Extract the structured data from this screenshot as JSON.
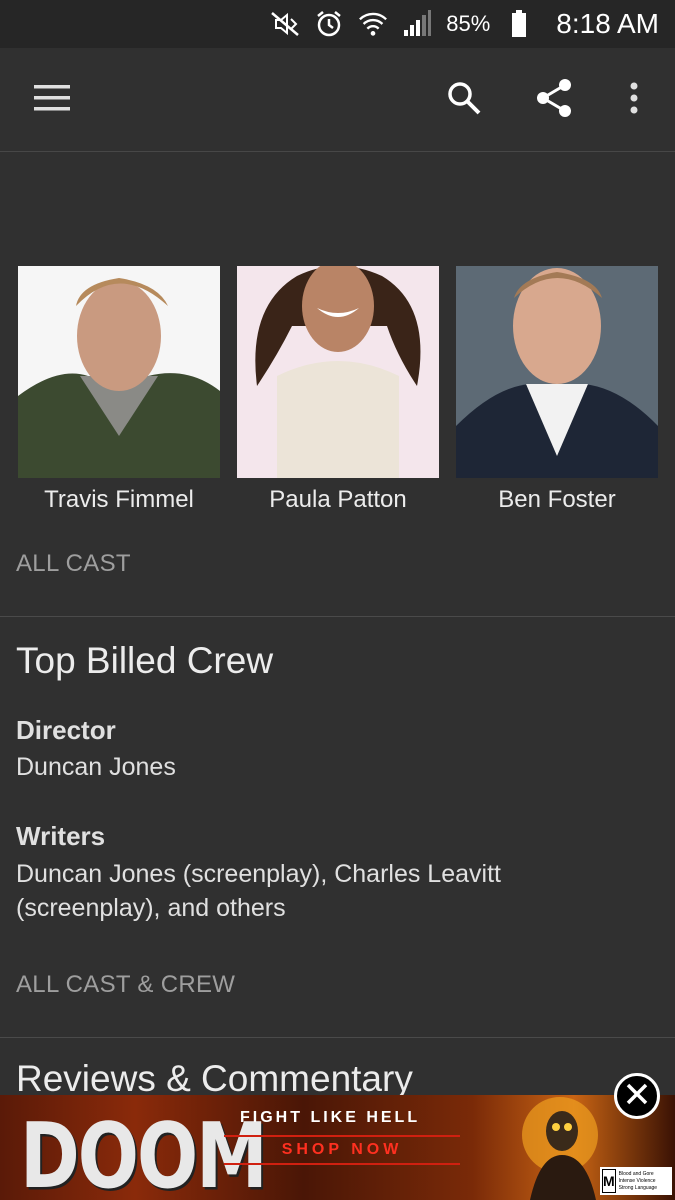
{
  "status_bar": {
    "battery_percent": "85%",
    "time": "8:18 AM",
    "icons": [
      "mute-icon",
      "alarm-icon",
      "wifi-icon",
      "signal-icon",
      "battery-icon"
    ]
  },
  "app_bar": {
    "icons": [
      "menu-icon",
      "search-icon",
      "share-icon",
      "more-vert-icon"
    ]
  },
  "cast": [
    {
      "name": "Travis Fimmel"
    },
    {
      "name": "Paula Patton"
    },
    {
      "name": "Ben Foster"
    }
  ],
  "all_cast_link": "ALL CAST",
  "crew_section": {
    "title": "Top Billed Crew",
    "roles": [
      {
        "label": "Director",
        "value": "Duncan Jones"
      },
      {
        "label": "Writers",
        "value": "Duncan Jones (screenplay), Charles Leavitt (screenplay), and others"
      }
    ],
    "all_cast_crew_link": "ALL CAST & CREW"
  },
  "reviews_section": {
    "title": "Reviews & Commentary"
  },
  "ad": {
    "logo_text": "DOOM",
    "tagline": "FIGHT LIKE HELL",
    "button": "SHOP NOW",
    "rating_letter": "M",
    "rating_descriptors": "Blood and Gore Intense Violence Strong Language"
  },
  "colors": {
    "background": "#303030",
    "status_bar": "#262626",
    "link_gray": "#9e9e9e",
    "ad_red": "#ff3020"
  }
}
